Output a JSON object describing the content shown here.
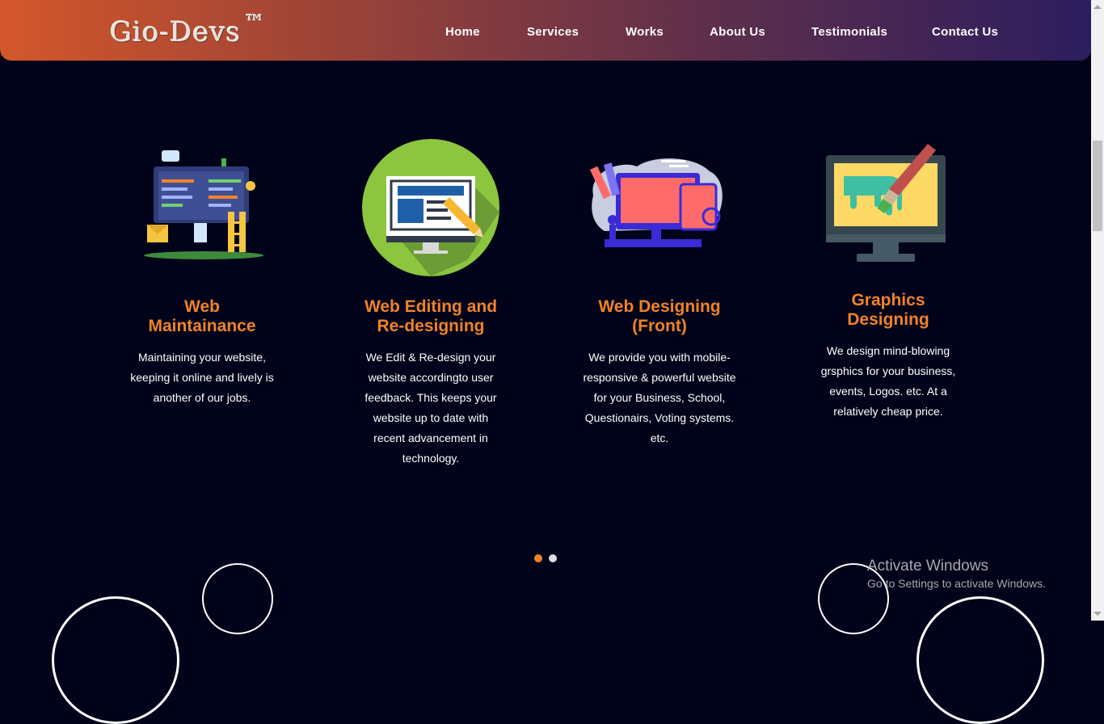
{
  "header": {
    "logo_text": "Gio-Devs",
    "logo_tm": "™",
    "nav": [
      {
        "label": "Home"
      },
      {
        "label": "Services"
      },
      {
        "label": "Works"
      },
      {
        "label": "About Us"
      },
      {
        "label": "Testimonials"
      },
      {
        "label": "Contact Us"
      }
    ]
  },
  "services": [
    {
      "title": "Web Maintainance",
      "description": "Maintaining your website, keeping it online and lively is another of our jobs.",
      "icon": "web-maintenance-icon"
    },
    {
      "title": "Web Editing and Re-designing",
      "description": "We Edit & Re-design your website accordingto user feedback. This keeps your website up to date with recent advancement in technology.",
      "icon": "web-editing-icon"
    },
    {
      "title": "Web Designing (Front)",
      "description": "We provide you with mobile-responsive & powerful website for your Business, School, Questionairs, Voting systems. etc.",
      "icon": "web-designing-icon"
    },
    {
      "title": "Graphics Designing",
      "description": "We design mind-blowing grsphics for your business, events, Logos. etc. At a relatively cheap price.",
      "icon": "graphics-design-icon"
    }
  ],
  "carousel": {
    "active_index": 0,
    "count": 2,
    "active_color": "#f0822a",
    "inactive_color": "#dddddd"
  },
  "watermark": {
    "title": "Activate Windows",
    "subtitle": "Go to Settings to activate Windows."
  },
  "colors": {
    "accent": "#f0822a",
    "background": "#01031a"
  }
}
